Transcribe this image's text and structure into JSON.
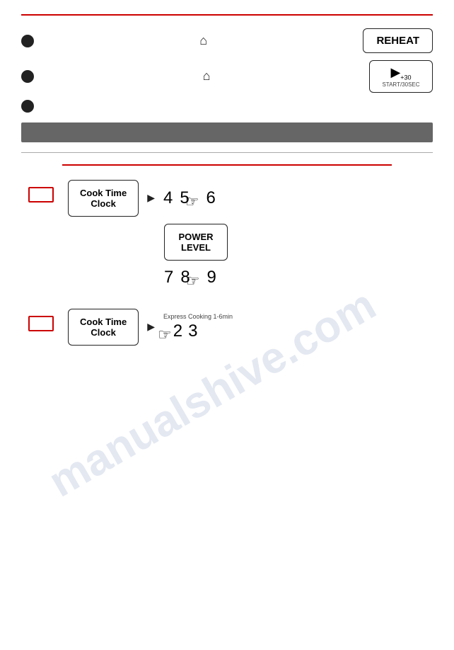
{
  "top": {
    "row1": {
      "text": "",
      "icon1": "⌂",
      "button": "REHEAT"
    },
    "row2": {
      "text": "",
      "icon1": "⌂",
      "button_icon": "▶",
      "button_label": "START/30SEC"
    },
    "row3": {
      "text": ""
    }
  },
  "diagram1": {
    "cook_time_label": "Cook Time\nClock",
    "arrow": "▶",
    "nums": [
      "4",
      "5",
      "6"
    ],
    "pressing_index": 1
  },
  "power_level": {
    "label": "POWER\nLEVEL"
  },
  "diagram1b": {
    "nums": [
      "7",
      "8",
      "9"
    ],
    "pressing_index": 1
  },
  "diagram2": {
    "cook_time_label": "Cook Time\nClock",
    "arrow": "▶",
    "express_label": "Express Cooking 1-6min",
    "nums": [
      "2",
      "3"
    ],
    "pressing_index": 0
  },
  "watermark": "manualshive.com"
}
